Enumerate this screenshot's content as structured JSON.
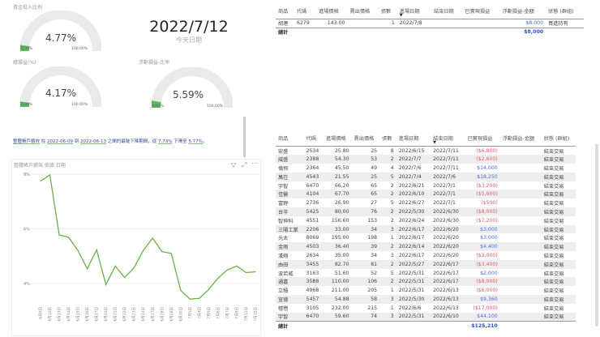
{
  "gauges": [
    {
      "title": "資金投入比例",
      "value": "4.77%",
      "fraction": 0.0477,
      "min": "0.00%",
      "max": "100.00%"
    },
    {
      "title": "總損益(%)",
      "value": "4.17%",
      "fraction": 0.0417,
      "min": "0.00%",
      "max": "100.00%"
    },
    {
      "title": "浮動損益-比率",
      "value": "5.59%",
      "fraction": 0.0559,
      "min": "0.00%",
      "max": "100.00%"
    }
  ],
  "today": {
    "date": "2022/7/12",
    "label": "今天日期"
  },
  "note": {
    "a": "整體帳戶績效",
    "b": " 在 ",
    "c": "2022-06-09",
    "d": " 到 ",
    "e": "2022-06-13",
    "f": " 之間的最陡下降期間，從 ",
    "g": "7.73%",
    "h": " 下滑至 ",
    "i": "5.77%",
    "j": "。"
  },
  "headers": [
    "商品",
    "代碼",
    "進場價格",
    "賣出價格",
    "張數",
    "進場日期",
    "結束日期",
    "已實現損益",
    "浮動損益-金額",
    "狀態 (群組)"
  ],
  "open_table": {
    "rows": [
      [
        "胡連",
        "6279",
        "143.00",
        "",
        "1",
        "2022/7/8",
        "",
        "",
        "$8,000",
        "買進持有"
      ]
    ],
    "total_label": "總計",
    "total_float": "$8,000"
  },
  "closed_table": {
    "rows": [
      [
        "宏盛",
        "2534",
        "25.80",
        "25",
        "8",
        "2022/6/15",
        "2022/7/11",
        "($6,800)",
        "",
        "結束交易"
      ],
      [
        "威盛",
        "2388",
        "54.30",
        "53",
        "2",
        "2022/7/7",
        "2022/7/11",
        "($2,600)",
        "",
        "結束交易"
      ],
      [
        "倫飛",
        "2364",
        "45.50",
        "49",
        "4",
        "2022/7/6",
        "2022/7/11",
        "$14,000",
        "",
        "結束交易"
      ],
      [
        "萬在",
        "4543",
        "21.55",
        "25",
        "5",
        "2022/7/4",
        "2022/7/6",
        "$18,250",
        "",
        "結束交易"
      ],
      [
        "宇智",
        "6470",
        "66.20",
        "65",
        "2",
        "2022/6/21",
        "2022/7/1",
        "($3,200)",
        "",
        "結束交易"
      ],
      [
        "佳醫",
        "4104",
        "67.70",
        "65",
        "2",
        "2022/6/10",
        "2022/7/1",
        "($5,600)",
        "",
        "結束交易"
      ],
      [
        "富野",
        "2736",
        "26.90",
        "27",
        "5",
        "2022/6/27",
        "2022/7/1",
        "($500)",
        "",
        "結束交易"
      ],
      [
        "台半",
        "5425",
        "80.00",
        "76",
        "2",
        "2022/5/30",
        "2022/6/30",
        "($8,000)",
        "",
        "結束交易"
      ],
      [
        "智伸科",
        "4551",
        "156.60",
        "153",
        "2",
        "2022/6/24",
        "2022/6/30",
        "($7,200)",
        "",
        "結束交易"
      ],
      [
        "三陽工業",
        "2206",
        "33.00",
        "34",
        "3",
        "2022/6/17",
        "2022/6/20",
        "$3,000",
        "",
        "結束交易"
      ],
      [
        "元太",
        "8069",
        "195.00",
        "198",
        "1",
        "2022/6/17",
        "2022/6/20",
        "$3,000",
        "",
        "結束交易"
      ],
      [
        "金雨",
        "4503",
        "36.40",
        "39",
        "2",
        "2022/6/14",
        "2022/6/20",
        "$4,400",
        "",
        "結束交易"
      ],
      [
        "漢翔",
        "2634",
        "35.00",
        "34",
        "3",
        "2022/6/17",
        "2022/6/20",
        "($3,000)",
        "",
        "結束交易"
      ],
      [
        "由田",
        "3455",
        "82.70",
        "81",
        "2",
        "2022/5/27",
        "2022/6/17",
        "($3,400)",
        "",
        "結束交易"
      ],
      [
        "波若威",
        "3163",
        "51.60",
        "52",
        "5",
        "2022/5/31",
        "2022/6/17",
        "$2,000",
        "",
        "結束交易"
      ],
      [
        "通嘉",
        "3588",
        "110.00",
        "106",
        "2",
        "2022/5/31",
        "2022/6/17",
        "($8,000)",
        "",
        "結束交易"
      ],
      [
        "立積",
        "4968",
        "211.00",
        "205",
        "1",
        "2022/5/31",
        "2022/6/13",
        "($6,000)",
        "",
        "結束交易"
      ],
      [
        "宣德",
        "5457",
        "54.88",
        "58",
        "3",
        "2022/5/30",
        "2022/6/13",
        "$9,360",
        "",
        "結束交易"
      ],
      [
        "穩懋",
        "3105",
        "232.00",
        "215",
        "1",
        "2022/6/6",
        "2022/6/13",
        "($17,000)",
        "",
        "結束交易"
      ],
      [
        "宇智",
        "6470",
        "59.60",
        "74",
        "3",
        "2022/5/31",
        "2022/6/10",
        "$44,100",
        "",
        "結束交易"
      ]
    ],
    "total_label": "總計",
    "total_realized": "$125,210"
  },
  "chart_data": {
    "type": "line",
    "title": "整體帳戶績效 依據 日期",
    "xlabel": "",
    "ylabel": "",
    "x": [
      "6月9日",
      "6月10日",
      "6月13日",
      "6月14日",
      "6月15日",
      "6月16日",
      "6月17日",
      "6月20日",
      "6月21日",
      "6月22日",
      "6月23日",
      "6月24日",
      "6月27日",
      "6月28日",
      "6月29日",
      "6月30日",
      "7月1日",
      "7月4日",
      "7月5日",
      "7月6日",
      "7月7日",
      "7月8日",
      "7月11日",
      "7月12日"
    ],
    "values": [
      7.75,
      7.97,
      5.78,
      5.69,
      5.21,
      4.54,
      5.23,
      3.96,
      4.64,
      4.22,
      4.57,
      5.21,
      5.66,
      5.17,
      5.1,
      3.75,
      3.43,
      3.46,
      3.78,
      4.2,
      4.5,
      4.64,
      4.4,
      4.43
    ],
    "yticks": [
      "8%",
      "6%",
      "4%"
    ],
    "ytick_values": [
      8,
      6,
      4
    ],
    "ylim": [
      3,
      8.2
    ],
    "color": "#6ab04c"
  }
}
